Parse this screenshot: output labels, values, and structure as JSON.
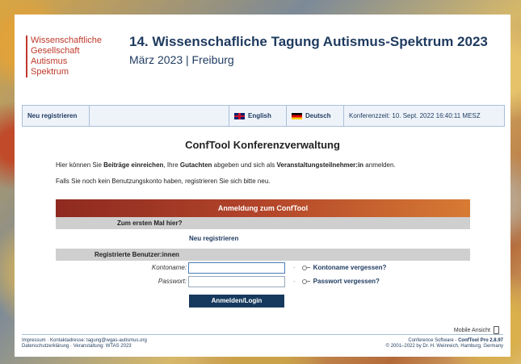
{
  "logo": {
    "lines": [
      "Wissenschaftliche",
      "Gesellschaft",
      "Autismus",
      "Spektrum"
    ]
  },
  "header": {
    "title": "14. Wissenschafliche Tagung Autismus-Spektrum 2023",
    "subtitle": "März 2023 | Freiburg"
  },
  "nav": {
    "register": "Neu registrieren",
    "english": "English",
    "deutsch": "Deutsch",
    "conftime": "Konferenzzeit: 10. Sept. 2022 16:40:11 MESZ"
  },
  "main": {
    "title": "ConfTool Konferenzverwaltung",
    "intro": {
      "p1": "Hier können Sie ",
      "p1b": "Beiträge einreichen",
      "p2": ", Ihre ",
      "p2b": "Gutachten",
      "p3": " abgeben und sich als ",
      "p3b": "Veranstaltungsteilnehmer:in",
      "p4": " anmelden."
    },
    "intro2": "Falls Sie noch kein Benutzungskonto haben, registrieren Sie sich bitte neu."
  },
  "login": {
    "header": "Anmeldung zum ConfTool",
    "first_time": "Zum ersten Mal hier?",
    "register_link": "Neu registrieren",
    "registered_users": "Registrierte Benutzer:innen",
    "account_label": "Kontoname:",
    "password_label": "Passwort:",
    "forgot_account": "Kontoname vergessen?",
    "forgot_password": "Passwort vergessen?",
    "dash": "-",
    "submit": "Anmelden/Login"
  },
  "footer": {
    "mobile": "Mobile Ansicht",
    "imprint": "Impressum",
    "sep": " · ",
    "contact_label": "Kontaktadresse:",
    "contact_email": " tagung@wgas-autismus.org",
    "privacy": "Datenschutzerklärung",
    "event": "Veranstaltung: WTAS 2023",
    "software": "Conference Software - ",
    "software_name": "ConfTool Pro 2.8.97",
    "copyright": "© 2001–2022 by Dr. H. Weinreich, Hamburg, Germany"
  }
}
